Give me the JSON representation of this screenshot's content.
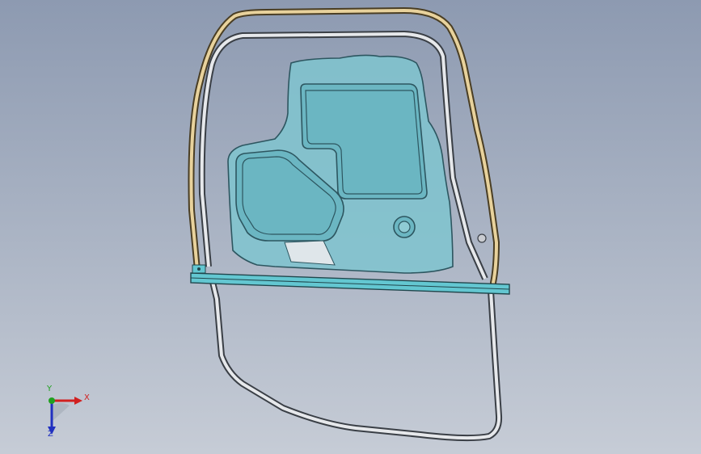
{
  "app": {
    "view": "isometric",
    "background_gradient": [
      "#8d9ab1",
      "#c6ccd6"
    ]
  },
  "model": {
    "parts": [
      {
        "name": "door-outer-frame",
        "color": "#c9ccd1"
      },
      {
        "name": "door-upper-tube",
        "color": "#d9c08a"
      },
      {
        "name": "inner-panel",
        "color": "#7fc4cf"
      },
      {
        "name": "belt-rail",
        "color": "#63c7d1"
      }
    ]
  },
  "triad": {
    "x_label": "X",
    "y_label": "Y",
    "z_label": "Z",
    "x_color": "#d12020",
    "y_color": "#20a020",
    "z_color": "#2030c0"
  }
}
